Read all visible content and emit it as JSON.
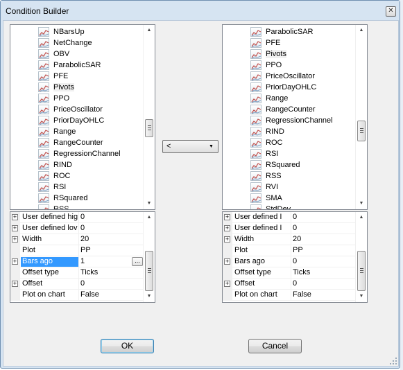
{
  "window": {
    "title": "Condition Builder",
    "close_glyph": "✕"
  },
  "left_list": {
    "items": [
      "NBarsUp",
      "NetChange",
      "OBV",
      "ParabolicSAR",
      "PFE",
      "Pivots",
      "PPO",
      "PriceOscillator",
      "PriorDayOHLC",
      "Range",
      "RangeCounter",
      "RegressionChannel",
      "RIND",
      "ROC",
      "RSI",
      "RSquared",
      "RSS"
    ],
    "selected": "Pivots"
  },
  "right_list": {
    "items": [
      "ParabolicSAR",
      "PFE",
      "Pivots",
      "PPO",
      "PriceOscillator",
      "PriorDayOHLC",
      "Range",
      "RangeCounter",
      "RegressionChannel",
      "RIND",
      "ROC",
      "RSI",
      "RSquared",
      "RSS",
      "RVI",
      "SMA",
      "StdDev"
    ],
    "selected": "Pivots"
  },
  "left_props": [
    {
      "name": "User defined hig",
      "value": "0",
      "expandable": true
    },
    {
      "name": "User defined lov",
      "value": "0",
      "expandable": true
    },
    {
      "name": "Width",
      "value": "20",
      "expandable": true
    },
    {
      "name": "Plot",
      "value": "PP",
      "expandable": false
    },
    {
      "name": "Bars ago",
      "value": "1",
      "expandable": true,
      "selected": true
    },
    {
      "name": "Offset type",
      "value": "Ticks",
      "expandable": false
    },
    {
      "name": "Offset",
      "value": "0",
      "expandable": true
    },
    {
      "name": "Plot on chart",
      "value": "False",
      "expandable": false
    }
  ],
  "right_props": [
    {
      "name": "User defined I",
      "value": "0",
      "expandable": true
    },
    {
      "name": "User defined I",
      "value": "0",
      "expandable": true
    },
    {
      "name": "Width",
      "value": "20",
      "expandable": true
    },
    {
      "name": "Plot",
      "value": "PP",
      "expandable": false
    },
    {
      "name": "Bars ago",
      "value": "0",
      "expandable": true
    },
    {
      "name": "Offset type",
      "value": "Ticks",
      "expandable": false
    },
    {
      "name": "Offset",
      "value": "0",
      "expandable": true
    },
    {
      "name": "Plot on chart",
      "value": "False",
      "expandable": false
    }
  ],
  "ellipsis_label": "...",
  "operator": {
    "value": "<"
  },
  "buttons": {
    "ok": "OK",
    "cancel": "Cancel"
  },
  "colors": {
    "selection": "#3399ff",
    "title_bar": "#d6e4f2",
    "client": "#f0f0f0"
  },
  "icons": {
    "indicator": "indicator-chart-icon",
    "expander": "plus-expander-icon"
  }
}
